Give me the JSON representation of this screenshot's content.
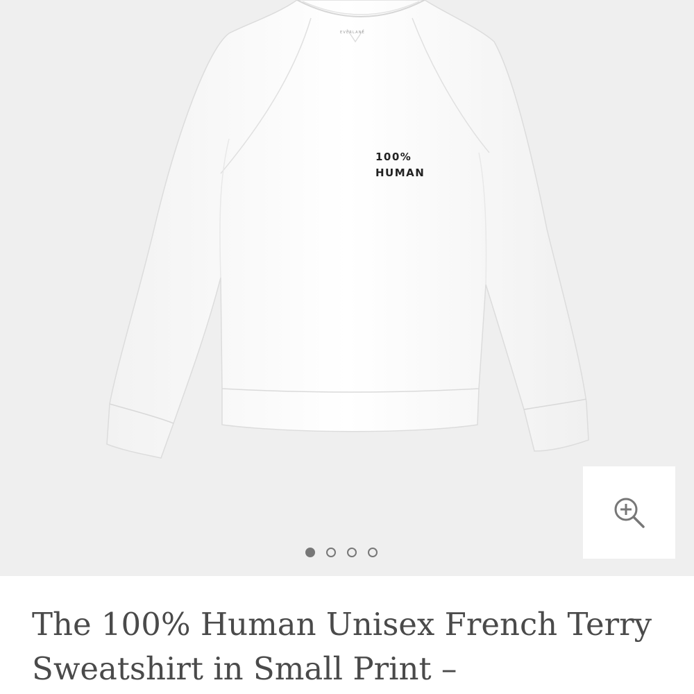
{
  "product": {
    "image": {
      "print_line1": "100%",
      "print_line2": "HUMAN",
      "brand_label": "EVERLANE"
    },
    "zoom_icon": "zoom-in-icon",
    "carousel": {
      "count": 4,
      "active_index": 0
    },
    "title": "The 100% Human Unisex French Terry Sweatshirt in Small Print –"
  },
  "colors": {
    "gallery_background": "#efefef",
    "text": "#4a4a4a",
    "dot": "#777777"
  }
}
